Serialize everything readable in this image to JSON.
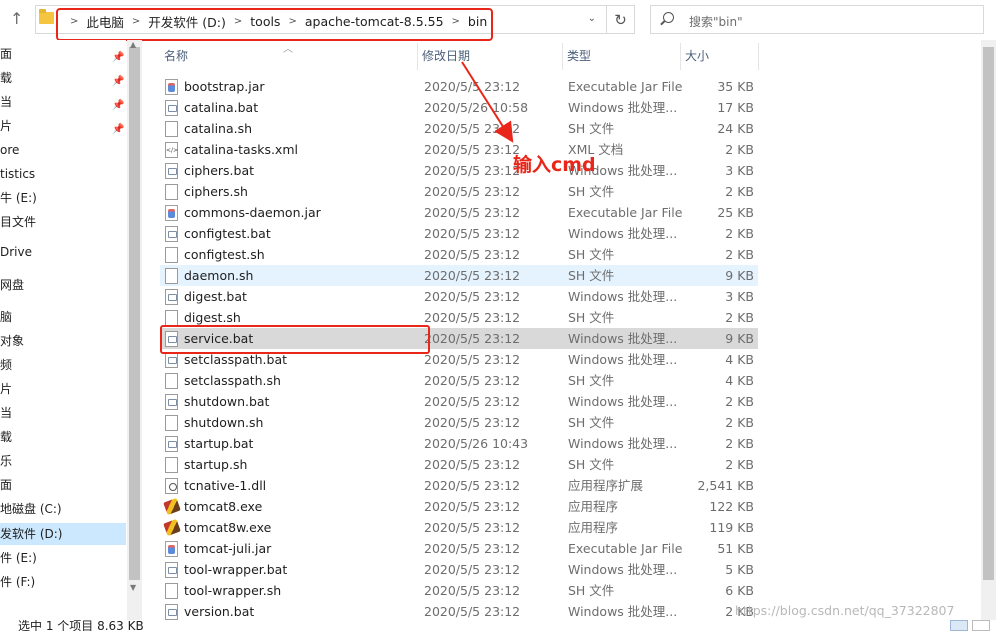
{
  "address_bar": {
    "crumbs": [
      "此电脑",
      "开发软件 (D:)",
      "tools",
      "apache-tomcat-8.5.55",
      "bin"
    ],
    "search_placeholder": "搜索\"bin\""
  },
  "sidebar": {
    "items": [
      {
        "label": "面",
        "pinned": true
      },
      {
        "label": "载",
        "pinned": true
      },
      {
        "label": "当",
        "pinned": true
      },
      {
        "label": "片",
        "pinned": true
      },
      {
        "label": "ore"
      },
      {
        "label": "tistics"
      },
      {
        "label": "牛 (E:)"
      },
      {
        "label": "目文件"
      },
      {
        "label": "Drive"
      },
      {
        "label": "网盘"
      },
      {
        "label": "脑"
      },
      {
        "label": "对象"
      },
      {
        "label": "频"
      },
      {
        "label": "片"
      },
      {
        "label": "当"
      },
      {
        "label": "载"
      },
      {
        "label": "乐"
      },
      {
        "label": "面"
      },
      {
        "label": "地磁盘 (C:)"
      },
      {
        "label": "发软件 (D:)",
        "selected": true
      },
      {
        "label": "件 (E:)"
      },
      {
        "label": "件 (F:)"
      }
    ]
  },
  "columns": {
    "name": "名称",
    "date": "修改日期",
    "type": "类型",
    "size": "大小"
  },
  "files": [
    {
      "name": "bootstrap.jar",
      "date": "2020/5/5 23:12",
      "type": "Executable Jar File",
      "size": "35 KB",
      "icon": "jar-icon"
    },
    {
      "name": "catalina.bat",
      "date": "2020/5/26 10:58",
      "type": "Windows 批处理...",
      "size": "17 KB",
      "icon": "bat-icon"
    },
    {
      "name": "catalina.sh",
      "date": "2020/5/5 23:12",
      "type": "SH 文件",
      "size": "24 KB",
      "icon": "file-icon"
    },
    {
      "name": "catalina-tasks.xml",
      "date": "2020/5/5 23:12",
      "type": "XML 文档",
      "size": "2 KB",
      "icon": "xml-icon"
    },
    {
      "name": "ciphers.bat",
      "date": "2020/5/5 23:12",
      "type": "Windows 批处理...",
      "size": "3 KB",
      "icon": "bat-icon"
    },
    {
      "name": "ciphers.sh",
      "date": "2020/5/5 23:12",
      "type": "SH 文件",
      "size": "2 KB",
      "icon": "file-icon"
    },
    {
      "name": "commons-daemon.jar",
      "date": "2020/5/5 23:12",
      "type": "Executable Jar File",
      "size": "25 KB",
      "icon": "jar-icon"
    },
    {
      "name": "configtest.bat",
      "date": "2020/5/5 23:12",
      "type": "Windows 批处理...",
      "size": "2 KB",
      "icon": "bat-icon"
    },
    {
      "name": "configtest.sh",
      "date": "2020/5/5 23:12",
      "type": "SH 文件",
      "size": "2 KB",
      "icon": "file-icon"
    },
    {
      "name": "daemon.sh",
      "date": "2020/5/5 23:12",
      "type": "SH 文件",
      "size": "9 KB",
      "icon": "file-icon",
      "state": "hover"
    },
    {
      "name": "digest.bat",
      "date": "2020/5/5 23:12",
      "type": "Windows 批处理...",
      "size": "3 KB",
      "icon": "bat-icon"
    },
    {
      "name": "digest.sh",
      "date": "2020/5/5 23:12",
      "type": "SH 文件",
      "size": "2 KB",
      "icon": "file-icon"
    },
    {
      "name": "service.bat",
      "date": "2020/5/5 23:12",
      "type": "Windows 批处理...",
      "size": "9 KB",
      "icon": "bat-icon",
      "state": "selected"
    },
    {
      "name": "setclasspath.bat",
      "date": "2020/5/5 23:12",
      "type": "Windows 批处理...",
      "size": "4 KB",
      "icon": "bat-icon"
    },
    {
      "name": "setclasspath.sh",
      "date": "2020/5/5 23:12",
      "type": "SH 文件",
      "size": "4 KB",
      "icon": "file-icon"
    },
    {
      "name": "shutdown.bat",
      "date": "2020/5/5 23:12",
      "type": "Windows 批处理...",
      "size": "2 KB",
      "icon": "bat-icon"
    },
    {
      "name": "shutdown.sh",
      "date": "2020/5/5 23:12",
      "type": "SH 文件",
      "size": "2 KB",
      "icon": "file-icon"
    },
    {
      "name": "startup.bat",
      "date": "2020/5/26 10:43",
      "type": "Windows 批处理...",
      "size": "2 KB",
      "icon": "bat-icon"
    },
    {
      "name": "startup.sh",
      "date": "2020/5/5 23:12",
      "type": "SH 文件",
      "size": "2 KB",
      "icon": "file-icon"
    },
    {
      "name": "tcnative-1.dll",
      "date": "2020/5/5 23:12",
      "type": "应用程序扩展",
      "size": "2,541 KB",
      "icon": "dll-icon"
    },
    {
      "name": "tomcat8.exe",
      "date": "2020/5/5 23:12",
      "type": "应用程序",
      "size": "122 KB",
      "icon": "tomcat-exe-icon"
    },
    {
      "name": "tomcat8w.exe",
      "date": "2020/5/5 23:12",
      "type": "应用程序",
      "size": "119 KB",
      "icon": "tomcat-exe-icon"
    },
    {
      "name": "tomcat-juli.jar",
      "date": "2020/5/5 23:12",
      "type": "Executable Jar File",
      "size": "51 KB",
      "icon": "jar-icon"
    },
    {
      "name": "tool-wrapper.bat",
      "date": "2020/5/5 23:12",
      "type": "Windows 批处理...",
      "size": "5 KB",
      "icon": "bat-icon"
    },
    {
      "name": "tool-wrapper.sh",
      "date": "2020/5/5 23:12",
      "type": "SH 文件",
      "size": "6 KB",
      "icon": "file-icon"
    },
    {
      "name": "version.bat",
      "date": "2020/5/5 23:12",
      "type": "Windows 批处理...",
      "size": "2 KB",
      "icon": "bat-icon"
    }
  ],
  "annotation": {
    "text": "输入cmd",
    "color": "#e8271a"
  },
  "status_bar": {
    "text": "选中 1 个项目  8.63 KB"
  },
  "watermark": "https://blog.csdn.net/qq_37322807",
  "colors": {
    "selected_row": "#d9d9d9",
    "hover_row": "#e5f3ff",
    "header_text": "#4c607a",
    "annotation_red": "#e8271a"
  }
}
